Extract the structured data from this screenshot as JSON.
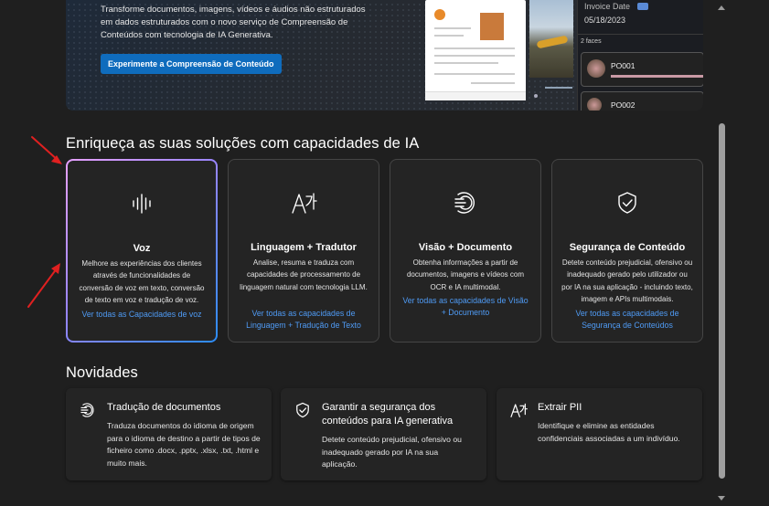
{
  "banner": {
    "text": "Transforme documentos, imagens, vídeos e áudios não estruturados em dados estruturados com o novo serviço de Compreensão de Conteúdos com tecnologia de IA Generativa.",
    "button_label": "Experimente a Compreensão de Conteúdo",
    "preview": {
      "invoice_field": "Invoice Date",
      "date": "05/18/2023",
      "faces_label": "2 faces",
      "face_1": "PO001",
      "face_2": "PO002"
    }
  },
  "sections": {
    "ai_heading": "Enriqueça as suas soluções com capacidades de IA",
    "news_heading": "Novidades"
  },
  "capabilities": [
    {
      "title": "Voz",
      "icon": "voice-waveform-icon",
      "description": "Melhore as experiências dos clientes através de funcionalidades de conversão de voz em texto, conversão de texto em voz e tradução de voz.",
      "link": "Ver todas as Capacidades de voz"
    },
    {
      "title": "Linguagem + Tradutor",
      "icon": "translate-icon",
      "description": "Analise, resuma e traduza com capacidades de processamento de linguagem natural com tecnologia LLM.",
      "link": "Ver todas as capacidades de Linguagem + Tradução de Texto"
    },
    {
      "title": "Visão + Documento",
      "icon": "vision-icon",
      "description": "Obtenha informações a partir de documentos, imagens e vídeos com OCR e IA multimodal.",
      "link": "Ver todas as capacidades de Visão + Documento"
    },
    {
      "title": "Segurança de Conteúdo",
      "icon": "shield-check-icon",
      "description": "Detete conteúdo prejudicial, ofensivo ou inadequado gerado pelo utilizador ou por IA na sua aplicação - incluindo texto, imagem e APIs multimodais.",
      "link": "Ver todas as capacidades de Segurança de Conteúdos"
    }
  ],
  "news": [
    {
      "title": "Tradução de documentos",
      "icon": "document-translate-icon",
      "description": "Traduza documentos do idioma de origem para o idioma de destino a partir de tipos de ficheiro como .docx, .pptx, .xlsx, .txt, .html e muito mais."
    },
    {
      "title": "Garantir a segurança dos conteúdos para IA generativa",
      "icon": "shield-check-icon",
      "description": "Detete conteúdo prejudicial, ofensivo ou inadequado gerado por IA na sua aplicação."
    },
    {
      "title": "Extrair PII",
      "icon": "translate-icon",
      "description": "Identifique e elimine as entidades confidenciais associadas a um indivíduo."
    }
  ],
  "colors": {
    "background": "#1f1f1f",
    "card": "#242424",
    "link": "#4f9bf5",
    "button": "#0f6cbd",
    "annotation_arrow": "#e02020"
  }
}
